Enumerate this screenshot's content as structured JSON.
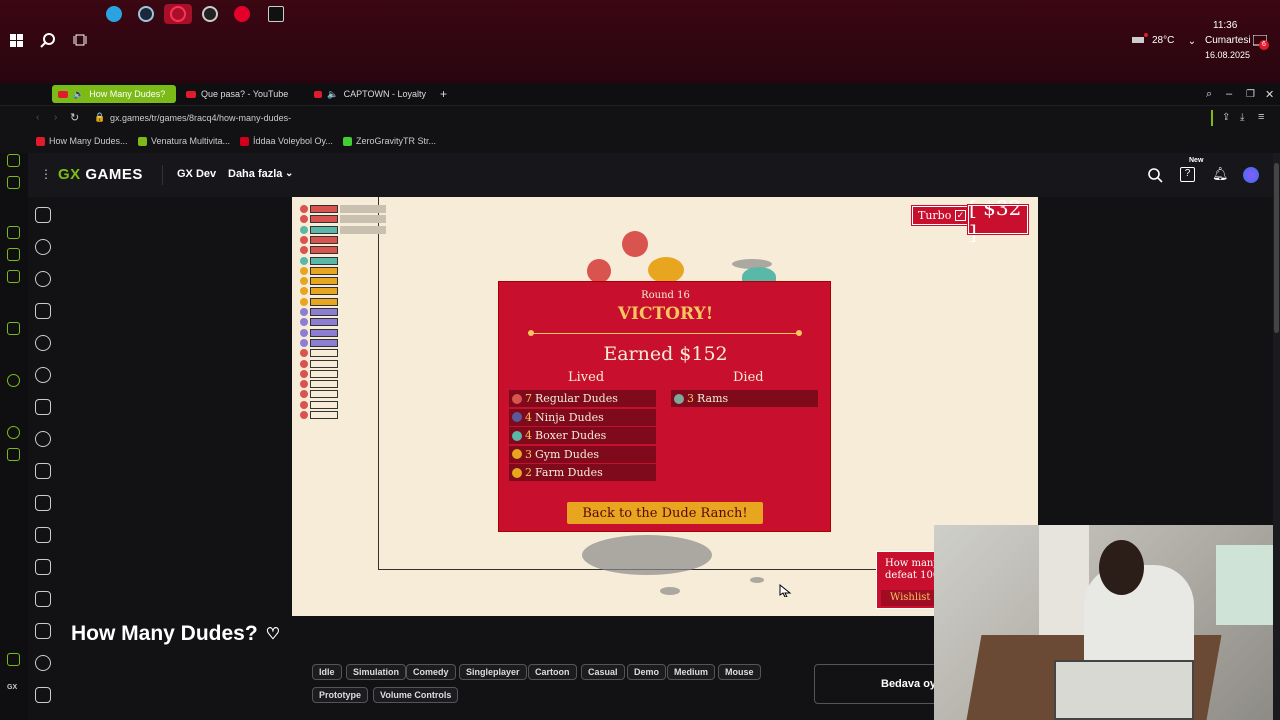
{
  "taskbar": {
    "temperature": "28°C",
    "time": "11:36",
    "day": "Cumartesi",
    "date": "16.08.2025",
    "notification_count": "6"
  },
  "browser": {
    "tabs": [
      {
        "label": "How Many Dudes?"
      },
      {
        "label": "Que pasa? - YouTube"
      },
      {
        "label": "CAPTOWN - Loyalty"
      }
    ],
    "url": "gx.games/tr/games/8racq4/how-many-dudes-",
    "bookmarks": [
      {
        "label": "How Many Dudes...",
        "color": "#e01b2b"
      },
      {
        "label": "Venatura Multivita...",
        "color": "#7cbb17"
      },
      {
        "label": "İddaa Voleybol Oy...",
        "color": "#d3001c"
      },
      {
        "label": "ZeroGravityTR Str...",
        "color": "#3fcf33"
      }
    ]
  },
  "gx_header": {
    "logo_prefix": "GX",
    "logo_text": " GAMES",
    "nav": [
      {
        "label": "GX Dev"
      },
      {
        "label": "Daha fazla"
      }
    ],
    "new_badge": "New"
  },
  "game": {
    "turbo_label": "Turbo",
    "money": "[ $32 ]",
    "victory": {
      "round": "Round 16",
      "title": "VICTORY!",
      "earned": "Earned $152",
      "lived_header": "Lived",
      "died_header": "Died",
      "lived": [
        {
          "count": "7",
          "label": "Regular Dudes",
          "color": "#d9534f"
        },
        {
          "count": "4",
          "label": "Ninja Dudes",
          "color": "#5a5a9a"
        },
        {
          "count": "4",
          "label": "Boxer Dudes",
          "color": "#59b8a8"
        },
        {
          "count": "3",
          "label": "Gym Dudes",
          "color": "#e8a51f"
        },
        {
          "count": "2",
          "label": "Farm Dudes",
          "color": "#e8a51f"
        }
      ],
      "died": [
        {
          "count": "3",
          "label": "Rams",
          "color": "#7fa89a"
        }
      ],
      "back_button": "Back to the Dude Ranch!"
    },
    "wishlist": {
      "text_line1": "How many d",
      "text_line2": "defeat 100",
      "button": "Wishlist o"
    }
  },
  "page": {
    "game_title": "How Many Dudes?",
    "tags": [
      "Idle",
      "Simulation",
      "Comedy",
      "Singleplayer",
      "Cartoon",
      "Casual",
      "Demo",
      "Medium",
      "Mouse",
      "Prototype",
      "Volume Controls"
    ],
    "play_button": "Bedava oy"
  },
  "colors": {
    "accent": "#7cbb17",
    "game_red": "#c8102e",
    "game_gold": "#f6c85f",
    "game_bg": "#f7ecd8"
  }
}
